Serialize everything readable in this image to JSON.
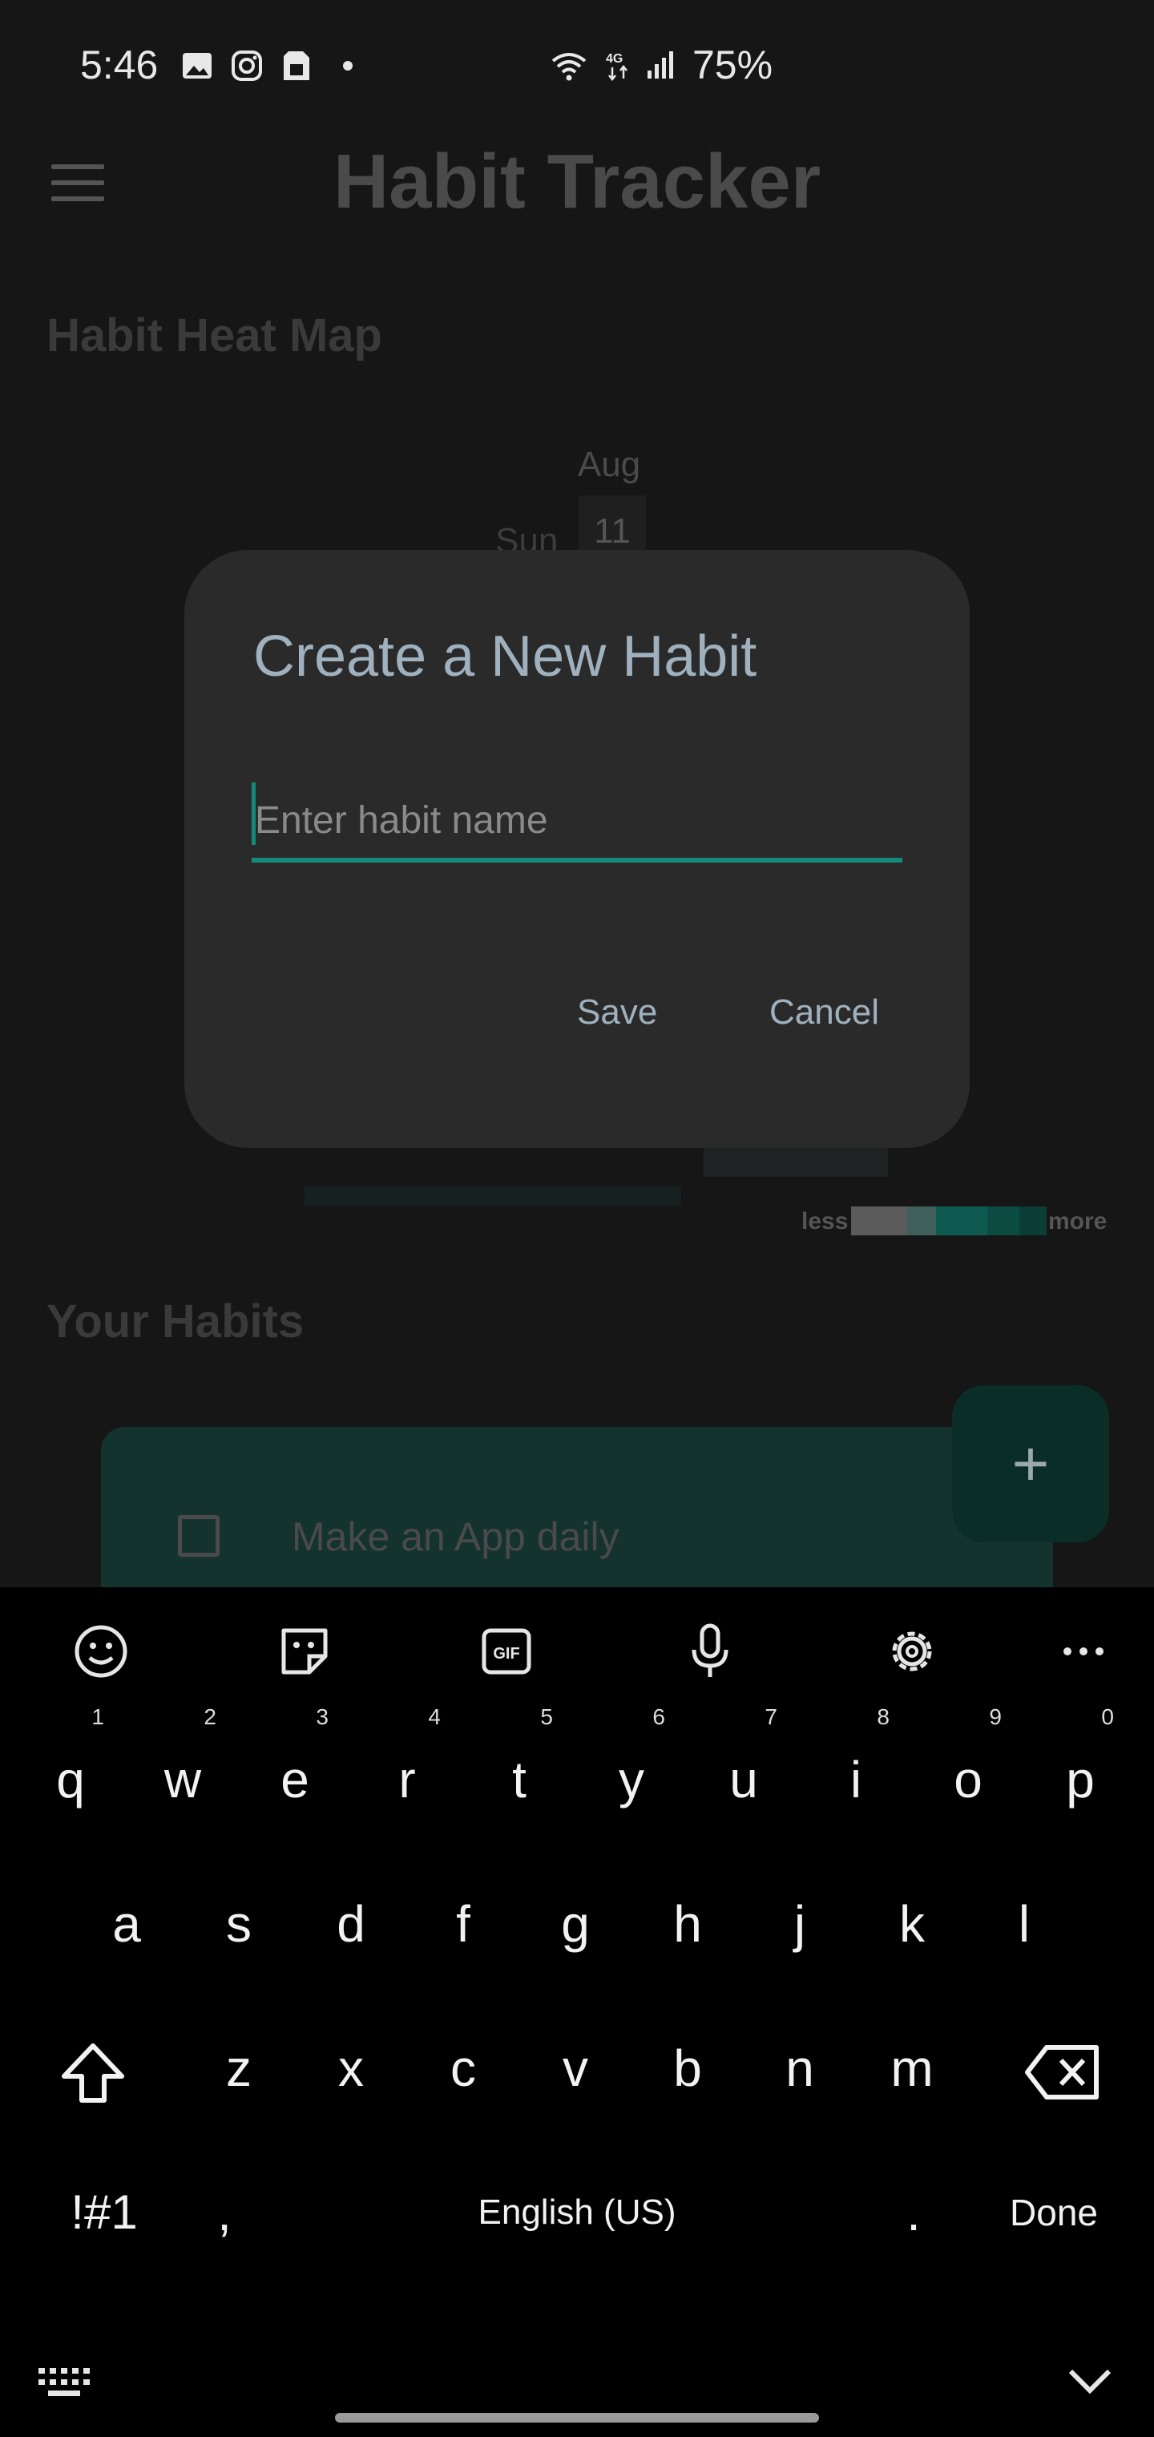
{
  "status_bar": {
    "time": "5:46",
    "battery": "75%",
    "left_icons": [
      "gallery-icon",
      "instagram-icon",
      "sim-card-icon",
      "notification-dot-icon"
    ],
    "right_icons": [
      "wifi-icon",
      "4g-icon",
      "signal-icon"
    ]
  },
  "app": {
    "title": "Habit Tracker",
    "menu_icon": "hamburger-menu-icon"
  },
  "heatmap": {
    "title": "Habit Heat Map",
    "month_label": "Aug",
    "weekday_label": "Sun",
    "day_label": "11",
    "legend_less": "less",
    "legend_more": "more",
    "legend_colors": [
      "#5b5b5b",
      "#3e5f5a",
      "#0e5a50",
      "#0b4b42",
      "#0a3d36"
    ]
  },
  "habits": {
    "title": "Your Habits",
    "items": [
      {
        "label": "Make an App daily",
        "checked": false
      }
    ],
    "add_button_icon": "plus-icon"
  },
  "dialog": {
    "title": "Create a New Habit",
    "input_placeholder": "Enter habit name",
    "input_value": "",
    "save_label": "Save",
    "cancel_label": "Cancel",
    "accent_color": "#148a7c"
  },
  "keyboard": {
    "toolbar": [
      "emoji-icon",
      "sticker-icon",
      "gif-icon",
      "microphone-icon",
      "settings-icon",
      "more-icon"
    ],
    "row1": [
      {
        "k": "q",
        "h": "1"
      },
      {
        "k": "w",
        "h": "2"
      },
      {
        "k": "e",
        "h": "3"
      },
      {
        "k": "r",
        "h": "4"
      },
      {
        "k": "t",
        "h": "5"
      },
      {
        "k": "y",
        "h": "6"
      },
      {
        "k": "u",
        "h": "7"
      },
      {
        "k": "i",
        "h": "8"
      },
      {
        "k": "o",
        "h": "9"
      },
      {
        "k": "p",
        "h": "0"
      }
    ],
    "row2": [
      "a",
      "s",
      "d",
      "f",
      "g",
      "h",
      "j",
      "k",
      "l"
    ],
    "row3": [
      "z",
      "x",
      "c",
      "v",
      "b",
      "n",
      "m"
    ],
    "symbols_label": "!#1",
    "comma_label": ",",
    "space_label": "English (US)",
    "period_label": ".",
    "done_label": "Done"
  }
}
